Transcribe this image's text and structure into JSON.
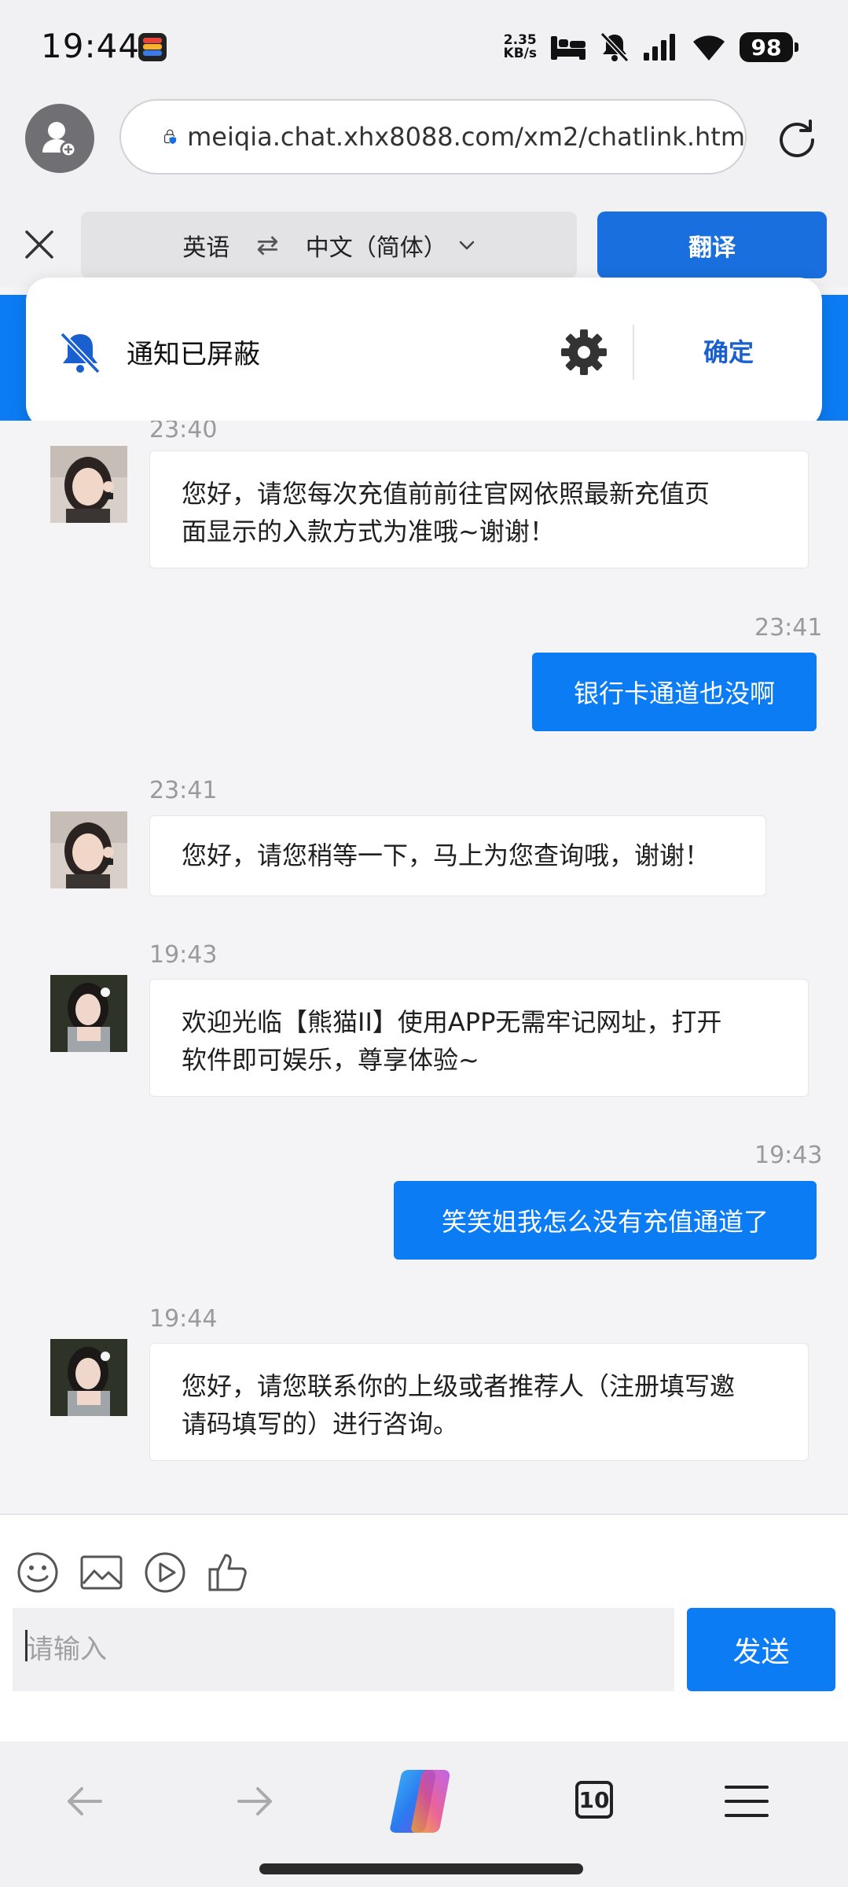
{
  "status_bar": {
    "time": "19:44",
    "net_speed_value": "2.35",
    "net_speed_unit": "KB/s",
    "battery": "98",
    "icons": [
      "sleep-icon",
      "mute-icon",
      "signal-icon",
      "wifi-icon"
    ]
  },
  "browser": {
    "url": "meiqia.chat.xhx8088.com/xm2/chatlink.htm",
    "tab_count": "10"
  },
  "translate_bar": {
    "source_lang": "英语",
    "swap_symbol": "⇄",
    "target_lang": "中文（简体）",
    "translate_label": "翻译"
  },
  "notification": {
    "text": "通知已屏蔽",
    "confirm_label": "确定"
  },
  "chat": {
    "partial_timestamp": "23:40",
    "messages": [
      {
        "side": "left",
        "time": "",
        "lines": [
          "您好，请您每次充值前前往官网依照最新充值页",
          "面显示的入款方式为准哦~谢谢！"
        ]
      },
      {
        "side": "right",
        "time": "23:41",
        "text": "银行卡通道也没啊"
      },
      {
        "side": "left",
        "time": "23:41",
        "lines": [
          "您好，请您稍等一下，马上为您查询哦，谢谢！"
        ]
      },
      {
        "side": "left",
        "time": "19:43",
        "lines": [
          "欢迎光临【熊猫II】使用APP无需牢记网址，打开",
          "软件即可娱乐，尊享体验~"
        ]
      },
      {
        "side": "right",
        "time": "19:43",
        "text": "笑笑姐我怎么没有充值通道了"
      },
      {
        "side": "left",
        "time": "19:44",
        "lines": [
          "您好，请您联系你的上级或者推荐人（注册填写邀",
          "请码填写的）进行咨询。"
        ]
      }
    ]
  },
  "composer": {
    "placeholder": "请输入",
    "send_label": "发送",
    "tools": [
      "emoji-icon",
      "image-icon",
      "video-icon",
      "thumbs-up-icon"
    ]
  },
  "colors": {
    "accent": "#0b7cf4",
    "translate_button": "#1a6fde",
    "confirm_text": "#1a5fd0"
  }
}
